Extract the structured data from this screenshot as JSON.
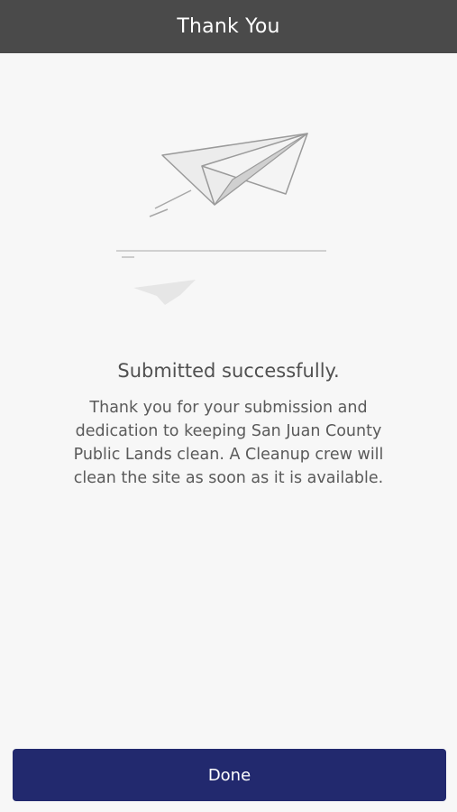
{
  "header": {
    "title": "Thank You"
  },
  "main": {
    "heading": "Submitted successfully.",
    "message": "Thank you for your submission and dedication to keeping San Juan County Public Lands clean. A Cleanup crew will clean the site as soon as it is available.",
    "illustration_icon": "paper-plane-icon"
  },
  "footer": {
    "done_label": "Done"
  },
  "colors": {
    "header_bg": "#4a4a4a",
    "button_bg": "#22296e",
    "page_bg": "#f7f7f7"
  }
}
